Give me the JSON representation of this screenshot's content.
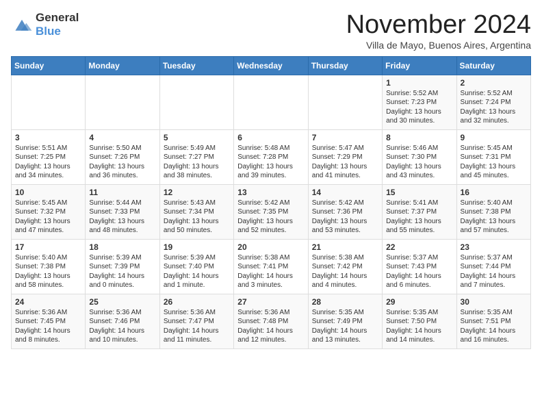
{
  "logo": {
    "general": "General",
    "blue": "Blue"
  },
  "header": {
    "month": "November 2024",
    "location": "Villa de Mayo, Buenos Aires, Argentina"
  },
  "weekdays": [
    "Sunday",
    "Monday",
    "Tuesday",
    "Wednesday",
    "Thursday",
    "Friday",
    "Saturday"
  ],
  "weeks": [
    [
      {
        "day": "",
        "info": ""
      },
      {
        "day": "",
        "info": ""
      },
      {
        "day": "",
        "info": ""
      },
      {
        "day": "",
        "info": ""
      },
      {
        "day": "",
        "info": ""
      },
      {
        "day": "1",
        "info": "Sunrise: 5:52 AM\nSunset: 7:23 PM\nDaylight: 13 hours\nand 30 minutes."
      },
      {
        "day": "2",
        "info": "Sunrise: 5:52 AM\nSunset: 7:24 PM\nDaylight: 13 hours\nand 32 minutes."
      }
    ],
    [
      {
        "day": "3",
        "info": "Sunrise: 5:51 AM\nSunset: 7:25 PM\nDaylight: 13 hours\nand 34 minutes."
      },
      {
        "day": "4",
        "info": "Sunrise: 5:50 AM\nSunset: 7:26 PM\nDaylight: 13 hours\nand 36 minutes."
      },
      {
        "day": "5",
        "info": "Sunrise: 5:49 AM\nSunset: 7:27 PM\nDaylight: 13 hours\nand 38 minutes."
      },
      {
        "day": "6",
        "info": "Sunrise: 5:48 AM\nSunset: 7:28 PM\nDaylight: 13 hours\nand 39 minutes."
      },
      {
        "day": "7",
        "info": "Sunrise: 5:47 AM\nSunset: 7:29 PM\nDaylight: 13 hours\nand 41 minutes."
      },
      {
        "day": "8",
        "info": "Sunrise: 5:46 AM\nSunset: 7:30 PM\nDaylight: 13 hours\nand 43 minutes."
      },
      {
        "day": "9",
        "info": "Sunrise: 5:45 AM\nSunset: 7:31 PM\nDaylight: 13 hours\nand 45 minutes."
      }
    ],
    [
      {
        "day": "10",
        "info": "Sunrise: 5:45 AM\nSunset: 7:32 PM\nDaylight: 13 hours\nand 47 minutes."
      },
      {
        "day": "11",
        "info": "Sunrise: 5:44 AM\nSunset: 7:33 PM\nDaylight: 13 hours\nand 48 minutes."
      },
      {
        "day": "12",
        "info": "Sunrise: 5:43 AM\nSunset: 7:34 PM\nDaylight: 13 hours\nand 50 minutes."
      },
      {
        "day": "13",
        "info": "Sunrise: 5:42 AM\nSunset: 7:35 PM\nDaylight: 13 hours\nand 52 minutes."
      },
      {
        "day": "14",
        "info": "Sunrise: 5:42 AM\nSunset: 7:36 PM\nDaylight: 13 hours\nand 53 minutes."
      },
      {
        "day": "15",
        "info": "Sunrise: 5:41 AM\nSunset: 7:37 PM\nDaylight: 13 hours\nand 55 minutes."
      },
      {
        "day": "16",
        "info": "Sunrise: 5:40 AM\nSunset: 7:38 PM\nDaylight: 13 hours\nand 57 minutes."
      }
    ],
    [
      {
        "day": "17",
        "info": "Sunrise: 5:40 AM\nSunset: 7:38 PM\nDaylight: 13 hours\nand 58 minutes."
      },
      {
        "day": "18",
        "info": "Sunrise: 5:39 AM\nSunset: 7:39 PM\nDaylight: 14 hours\nand 0 minutes."
      },
      {
        "day": "19",
        "info": "Sunrise: 5:39 AM\nSunset: 7:40 PM\nDaylight: 14 hours\nand 1 minute."
      },
      {
        "day": "20",
        "info": "Sunrise: 5:38 AM\nSunset: 7:41 PM\nDaylight: 14 hours\nand 3 minutes."
      },
      {
        "day": "21",
        "info": "Sunrise: 5:38 AM\nSunset: 7:42 PM\nDaylight: 14 hours\nand 4 minutes."
      },
      {
        "day": "22",
        "info": "Sunrise: 5:37 AM\nSunset: 7:43 PM\nDaylight: 14 hours\nand 6 minutes."
      },
      {
        "day": "23",
        "info": "Sunrise: 5:37 AM\nSunset: 7:44 PM\nDaylight: 14 hours\nand 7 minutes."
      }
    ],
    [
      {
        "day": "24",
        "info": "Sunrise: 5:36 AM\nSunset: 7:45 PM\nDaylight: 14 hours\nand 8 minutes."
      },
      {
        "day": "25",
        "info": "Sunrise: 5:36 AM\nSunset: 7:46 PM\nDaylight: 14 hours\nand 10 minutes."
      },
      {
        "day": "26",
        "info": "Sunrise: 5:36 AM\nSunset: 7:47 PM\nDaylight: 14 hours\nand 11 minutes."
      },
      {
        "day": "27",
        "info": "Sunrise: 5:36 AM\nSunset: 7:48 PM\nDaylight: 14 hours\nand 12 minutes."
      },
      {
        "day": "28",
        "info": "Sunrise: 5:35 AM\nSunset: 7:49 PM\nDaylight: 14 hours\nand 13 minutes."
      },
      {
        "day": "29",
        "info": "Sunrise: 5:35 AM\nSunset: 7:50 PM\nDaylight: 14 hours\nand 14 minutes."
      },
      {
        "day": "30",
        "info": "Sunrise: 5:35 AM\nSunset: 7:51 PM\nDaylight: 14 hours\nand 16 minutes."
      }
    ]
  ]
}
